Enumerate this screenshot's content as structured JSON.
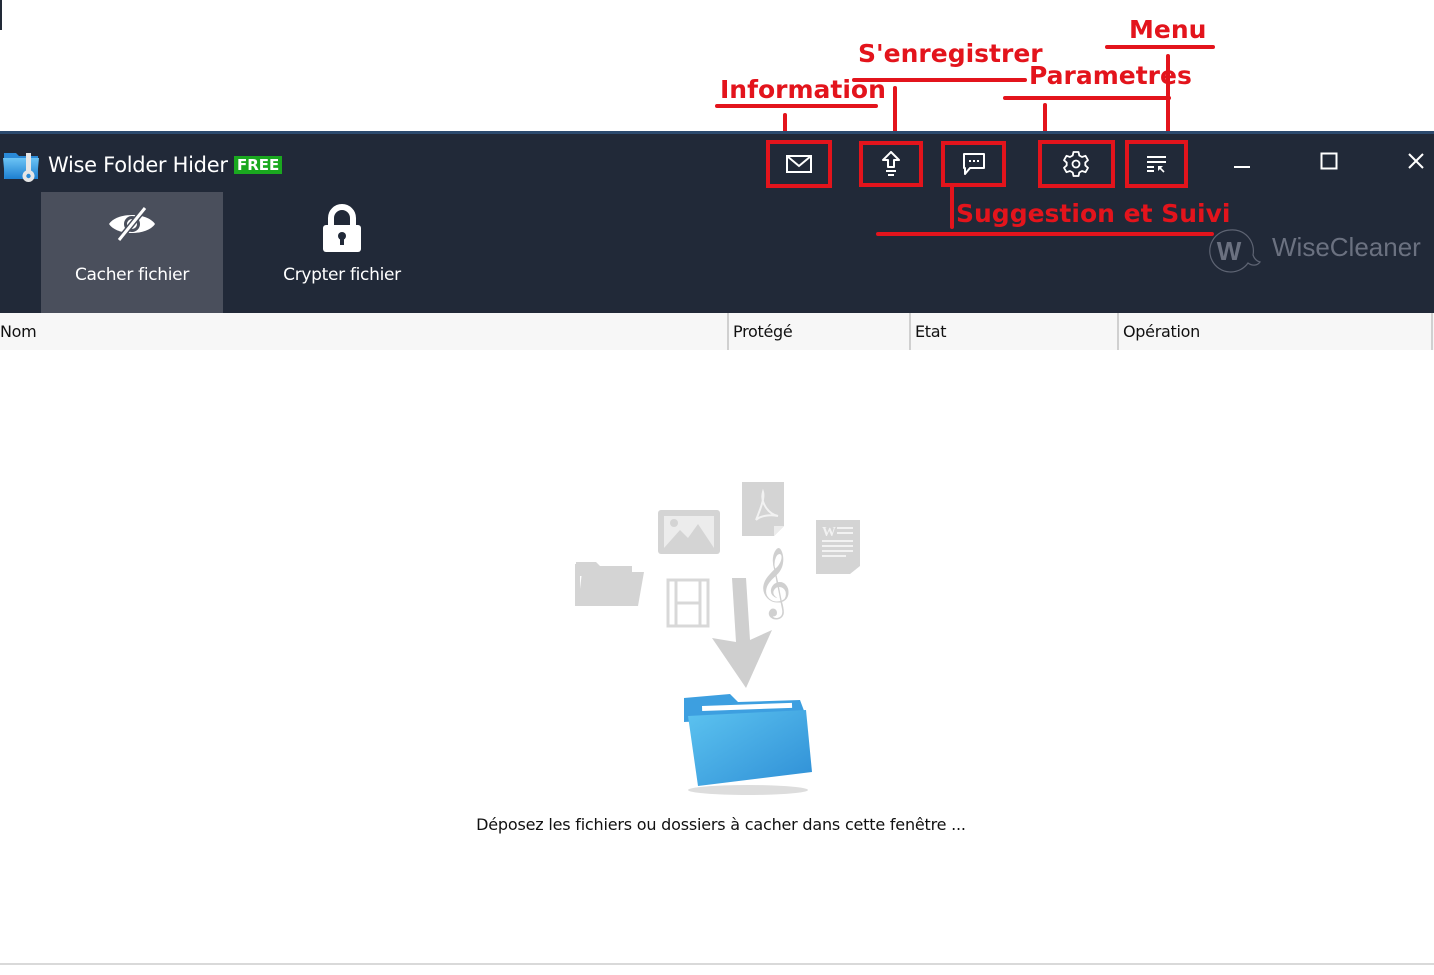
{
  "annotations": {
    "information": "Information",
    "register": "S'enregistrer",
    "settings": "Parametres",
    "menu": "Menu",
    "feedback": "Suggestion et Suivi",
    "color": "#e3141c"
  },
  "window": {
    "app_title": "Wise Folder Hider",
    "edition_badge": "FREE",
    "toolbar": [
      {
        "name": "information",
        "icon": "mail-icon"
      },
      {
        "name": "register",
        "icon": "upgrade-arrow-icon"
      },
      {
        "name": "feedback",
        "icon": "chat-bubble-icon"
      },
      {
        "name": "settings",
        "icon": "gear-icon"
      },
      {
        "name": "menu",
        "icon": "menu-list-icon"
      }
    ],
    "window_controls": [
      "minimize",
      "maximize",
      "close"
    ],
    "brand": "WiseCleaner",
    "brand_logo_letter": "W"
  },
  "tabs": [
    {
      "label": "Cacher fichier",
      "icon": "eye-slash-icon",
      "active": true
    },
    {
      "label": "Crypter fichier",
      "icon": "lock-icon",
      "active": false
    }
  ],
  "table": {
    "columns": [
      "Nom",
      "Protégé",
      "Etat",
      "Opération"
    ],
    "rows": []
  },
  "drop_zone": {
    "message": "Déposez les fichiers ou dossiers à cacher dans cette fenêtre ..."
  },
  "colors": {
    "header_bg": "#212938",
    "active_tab_bg": "#4a4f5c",
    "badge_green": "#1aa81f",
    "folder_blue": "#3a9ee0"
  }
}
